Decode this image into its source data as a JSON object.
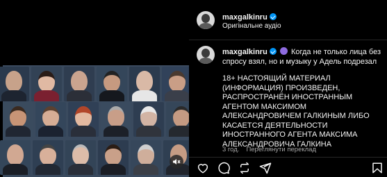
{
  "post": {
    "author": "maxgalkinru",
    "audio_label": "Оригінальне аудіо",
    "caption_author": "maxgalkinru",
    "caption_intro": "Когда не только лица без спросу взял, но и музыку у Адель подрезал",
    "caption_body": "18+ НАСТОЯЩИЙ МАТЕРИАЛ (ИНФОРМАЦИЯ) ПРОИЗВЕДЕН, РАСПРОСТРАНЁН ИНОСТРАННЫМ АГЕНТОМ МАКСИМОМ АЛЕКСАНДРОВИЧЕМ ГАЛКИНЫМ ЛИБО КАСАЕТСЯ ДЕЯТЕЛЬНОСТИ ИНОСТРАННОГО АГЕНТА МАКСИМА АЛЕКСАНДРОВИЧА ГАЛКИНА",
    "timestamp": "3 год.",
    "translate_label": "Переглянути переклад"
  },
  "icons": {
    "verified": "verified-badge-icon",
    "emoji": "emoji-icon",
    "like": "heart-icon",
    "comment": "comment-icon",
    "repost": "repost-icon",
    "share": "share-icon",
    "save": "bookmark-icon",
    "mute": "speaker-muted-icon"
  },
  "colors": {
    "background": "#000000",
    "text": "#f5f5f5",
    "secondary_text": "#a8a8a8",
    "verified": "#0095f6",
    "divider": "#262626"
  }
}
